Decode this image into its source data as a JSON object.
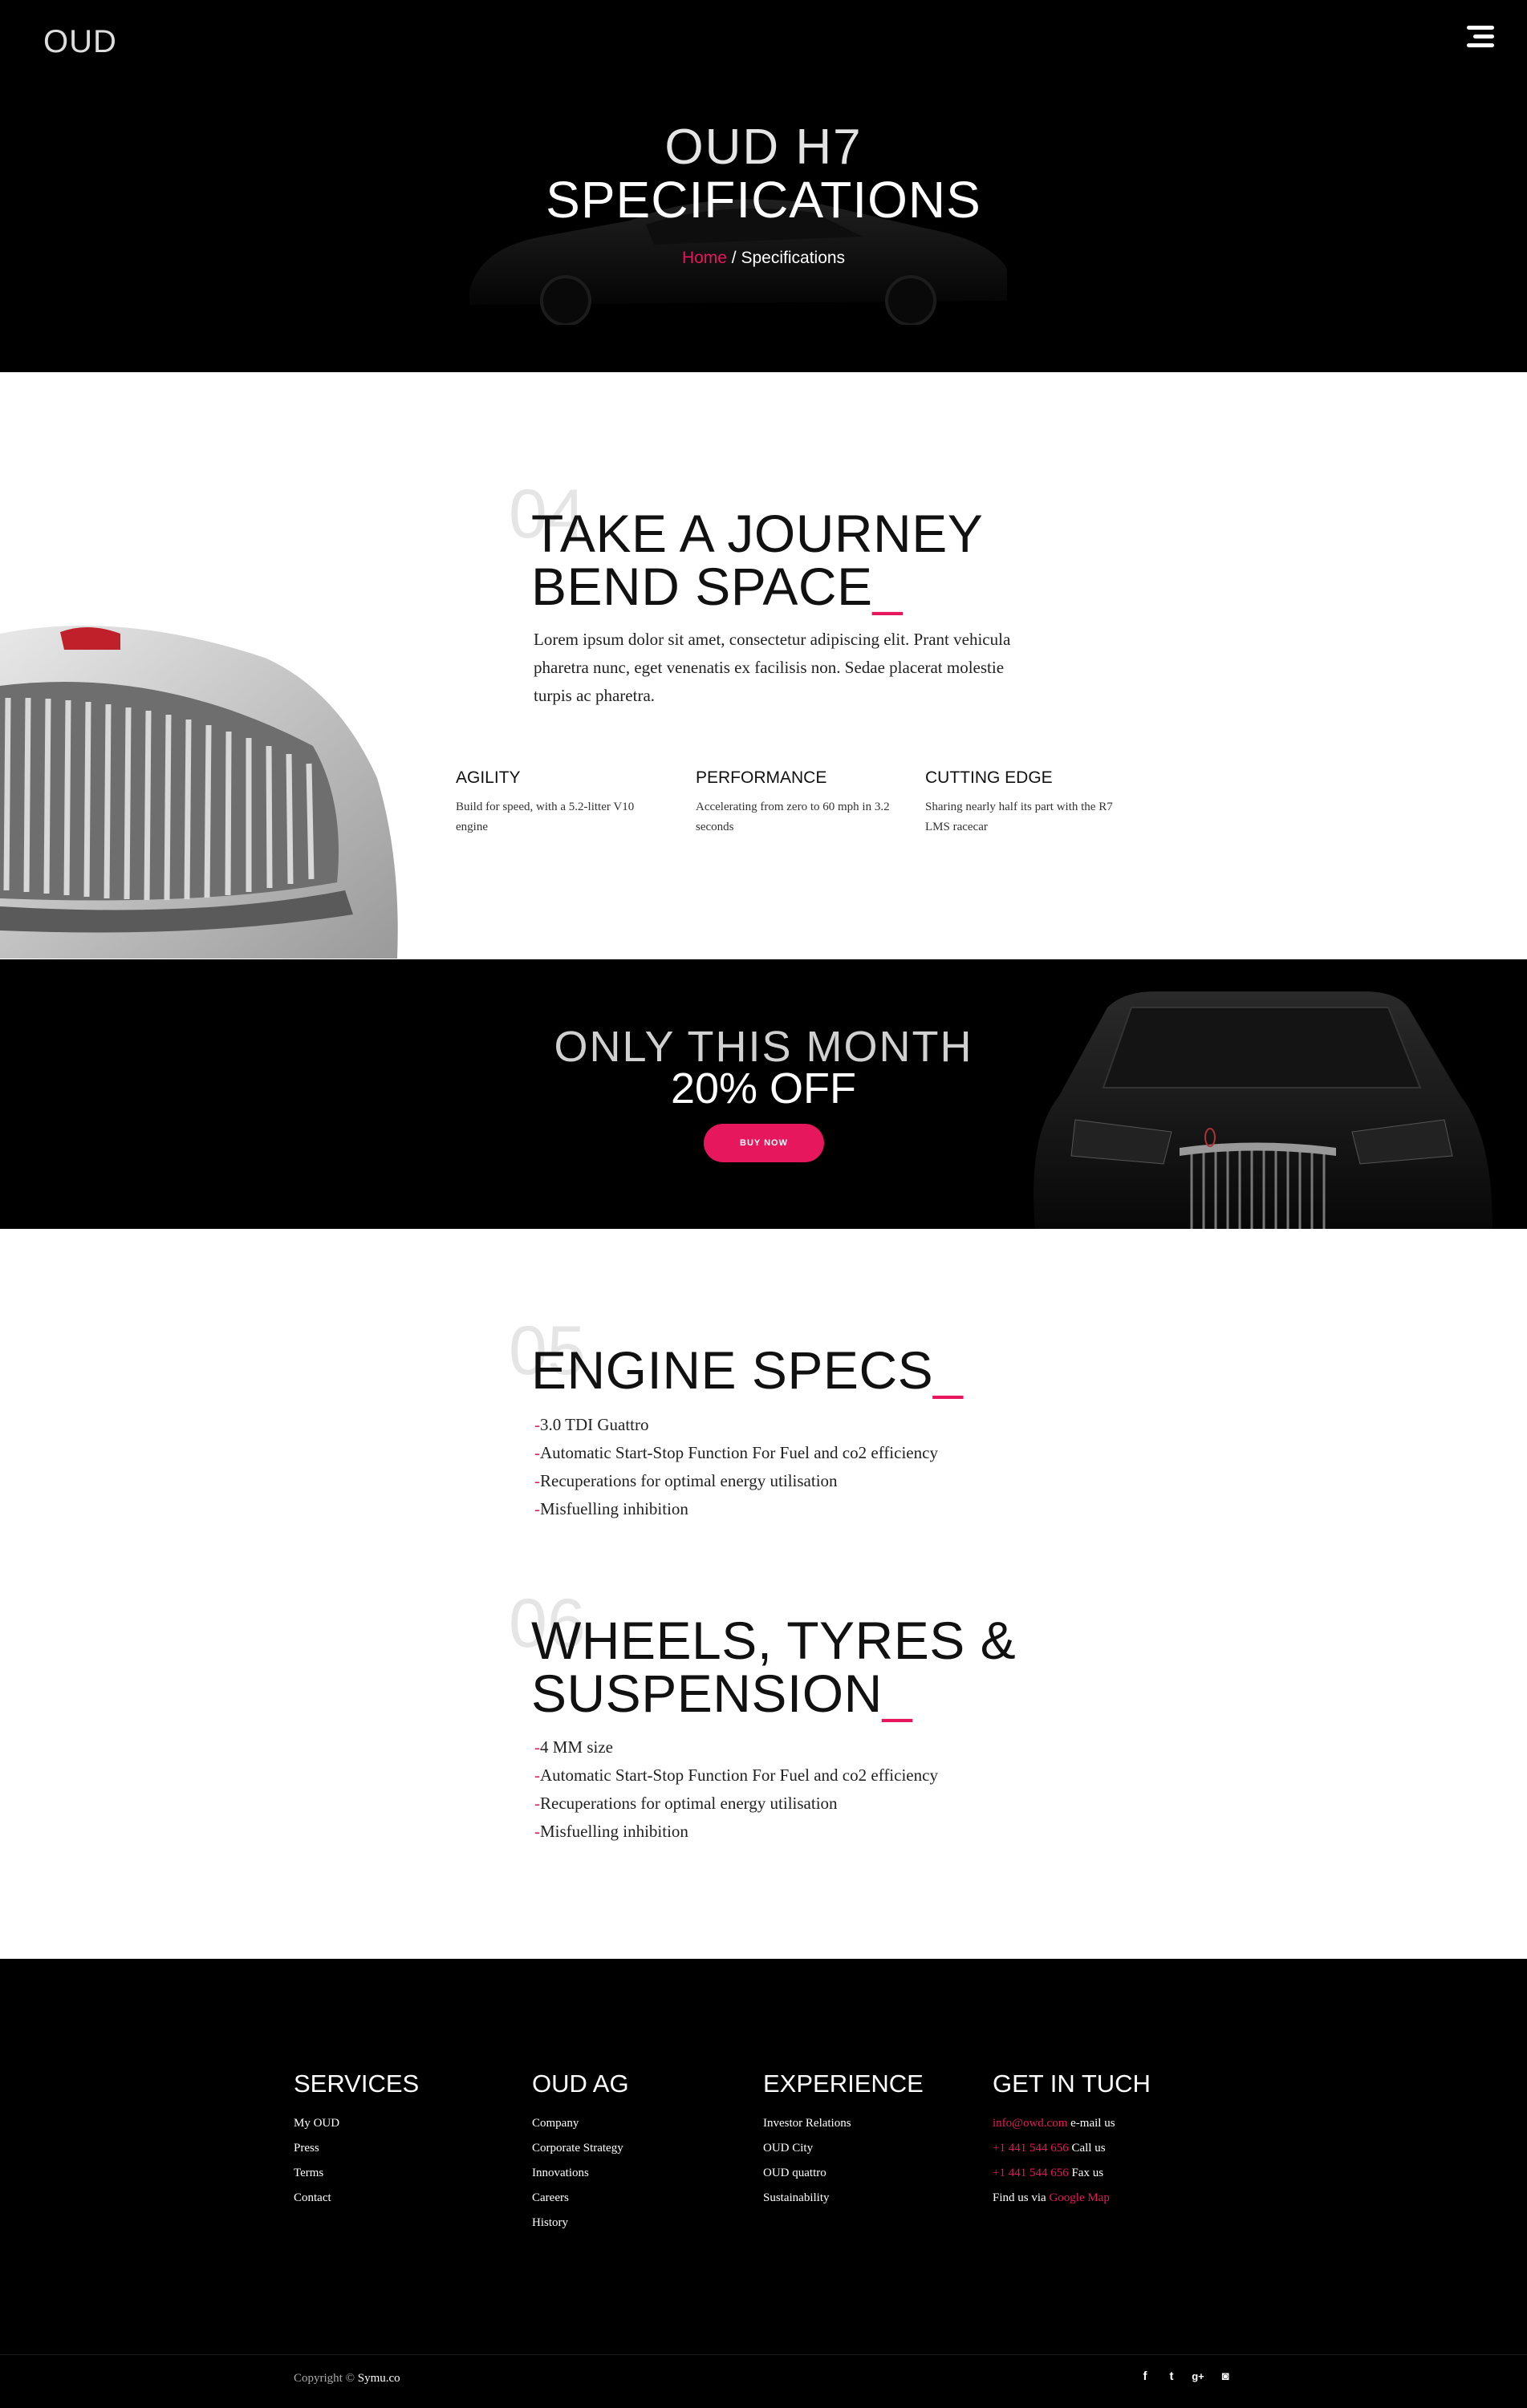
{
  "brand": {
    "logo": "OUD",
    "accent": "#e6175c"
  },
  "hero": {
    "subtitle": "OUD H7",
    "title": "SPECIFICATIONS",
    "breadcrumb_home": "Home",
    "breadcrumb_sep": " / ",
    "breadcrumb_current": "Specifications"
  },
  "intro": {
    "number": "04",
    "title_line1": "TAKE A JOURNEY",
    "title_line2": "BEND SPACE",
    "cursor": "_",
    "text": "Lorem ipsum dolor sit amet, consectetur adipiscing elit. Prant vehicula pharetra nunc, eget venenatis ex facilisis non. Sedae placerat molestie turpis ac pharetra.",
    "features": [
      {
        "title": "AGILITY",
        "text": "Build for speed, with a 5.2-litter V10 engine"
      },
      {
        "title": "PERFORMANCE",
        "text": "Accelerating from zero to 60 mph in 3.2 seconds"
      },
      {
        "title": "CUTTING EDGE",
        "text": "Sharing nearly half its part with the R7 LMS racecar"
      }
    ]
  },
  "promo": {
    "line1": "ONLY THIS MONTH",
    "line2": "20% OFF",
    "button": "BUY NOW"
  },
  "engine": {
    "number": "05",
    "title": "ENGINE SPECS",
    "cursor": "_",
    "dash": "-",
    "items": [
      "3.0 TDI Guattro",
      "Automatic Start-Stop Function For Fuel and co2 efficiency",
      "Recuperations for optimal energy utilisation",
      "Misfuelling inhibition"
    ]
  },
  "wheels": {
    "number": "06",
    "title_line1": "WHEELS, TYRES &",
    "title_line2": "SUSPENSION",
    "cursor": "_",
    "dash": "-",
    "items": [
      "4 MM size",
      "Automatic Start-Stop Function For Fuel and co2 efficiency",
      "Recuperations for optimal energy utilisation",
      "Misfuelling inhibition"
    ]
  },
  "footer": {
    "columns": [
      {
        "title": "SERVICES",
        "links": [
          "My OUD",
          "Press",
          "Terms",
          "Contact"
        ]
      },
      {
        "title": "OUD AG",
        "links": [
          "Company",
          "Corporate Strategy",
          "Innovations",
          "Careers",
          "History"
        ]
      },
      {
        "title": "EXPERIENCE",
        "links": [
          "Investor Relations",
          "OUD City",
          "OUD quattro",
          "Sustainability"
        ]
      }
    ],
    "contact": {
      "title": "GET IN TUCH",
      "email": "info@owd.com",
      "email_label": " e-mail us",
      "phone": "+1 441 544 656",
      "phone_label": " Call us",
      "fax": "+1 441 544 656",
      "fax_label": " Fax us",
      "map_prefix": "Find us via ",
      "map_link": "Google Map"
    },
    "copyright_prefix": "Copyright © ",
    "copyright_brand": "Symu.co",
    "social": [
      {
        "icon": "facebook-icon",
        "glyph": "f"
      },
      {
        "icon": "twitter-icon",
        "glyph": "t"
      },
      {
        "icon": "google-plus-icon",
        "glyph": "g+"
      },
      {
        "icon": "instagram-icon",
        "glyph": "◙"
      }
    ]
  }
}
